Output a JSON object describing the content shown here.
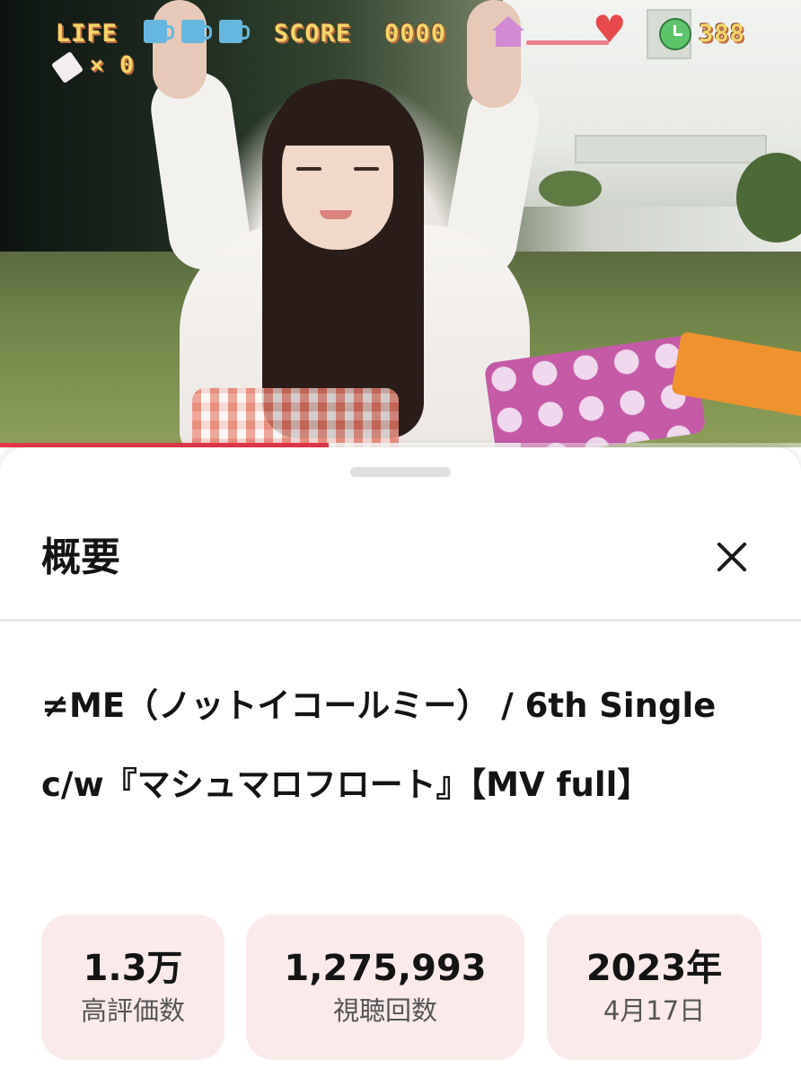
{
  "hud": {
    "life_label": "LIFE",
    "score_label": "SCORE",
    "score_value": "0000",
    "timer_value": "388",
    "item_count": "× 0",
    "icons": [
      "mug-icon",
      "house-icon",
      "heart-icon",
      "clock-icon"
    ]
  },
  "player": {
    "progress_percent": 41
  },
  "sheet": {
    "title": "概要",
    "close_icon": "close-icon",
    "video_title": "≠ME（ノットイコールミー） / 6th Single c/w『マシュマロフロート』【MV full】"
  },
  "stats": [
    {
      "value": "1.3万",
      "label": "高評価数"
    },
    {
      "value": "1,275,993",
      "label": "視聴回数"
    },
    {
      "value": "2023年",
      "label": "4月17日"
    }
  ],
  "colors": {
    "progress_red": "#e8394b",
    "stat_card_bg": "#faeaea",
    "hud_yellow": "#f4d66a"
  }
}
